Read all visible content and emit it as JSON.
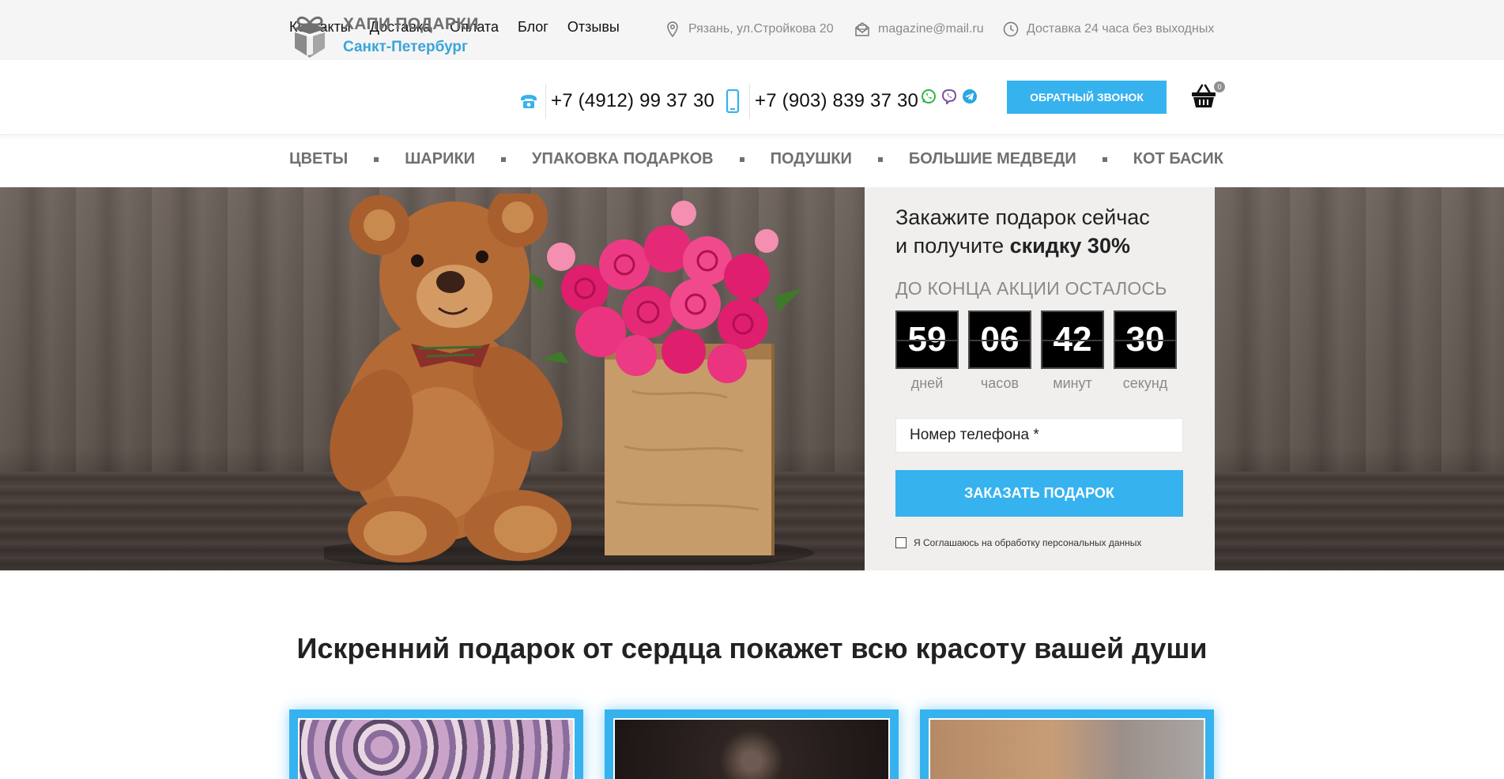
{
  "topbar": {
    "nav": [
      "Контакты",
      "Доставка",
      "Оплата",
      "Блог",
      "Отзывы"
    ],
    "address": "Рязань, ул.Стройкова 20",
    "email": "magazine@mail.ru",
    "hours": "Доставка 24 часа без выходных"
  },
  "header": {
    "brand_name": "ХАПИ ПОДАРКИ",
    "brand_city": "Санкт-Петербург",
    "phone_landline": "+7 (4912) 99 37 30",
    "phone_mobile": "+7 (903) 839 37 30",
    "messengers": [
      "whatsapp-icon",
      "viber-icon",
      "telegram-icon"
    ],
    "callback_label": "ОБРАТНЫЙ ЗВОНОК",
    "cart_count": "0"
  },
  "menu": [
    "ЦВЕТЫ",
    "ШАРИКИ",
    "УПАКОВКА ПОДАРКОВ",
    "ПОДУШКИ",
    "БОЛЬШИЕ МЕДВЕДИ",
    "КОТ БАСИК"
  ],
  "promo": {
    "title_line1": "Закажите подарок сейчас",
    "title_line2_prefix": "и получите ",
    "title_line2_bold": "скидку 30%",
    "countdown_caption": "ДО КОНЦА АКЦИИ ОСТАЛОСЬ",
    "countdown": [
      {
        "value": "59",
        "label": "дней"
      },
      {
        "value": "06",
        "label": "часов"
      },
      {
        "value": "42",
        "label": "минут"
      },
      {
        "value": "30",
        "label": "секунд"
      }
    ],
    "phone_placeholder": "Номер телефона *",
    "order_label": "ЗАКАЗАТЬ ПОДАРОК",
    "consent": "Я Соглашаюсь на обработку персональных данных"
  },
  "section": {
    "title": "Искренний подарок от сердца покажет всю красоту вашей души"
  },
  "colors": {
    "accent": "#36b2ee",
    "brand_city": "#3aa4db",
    "menu_text": "#707070",
    "promo_bg": "#f0efee"
  }
}
